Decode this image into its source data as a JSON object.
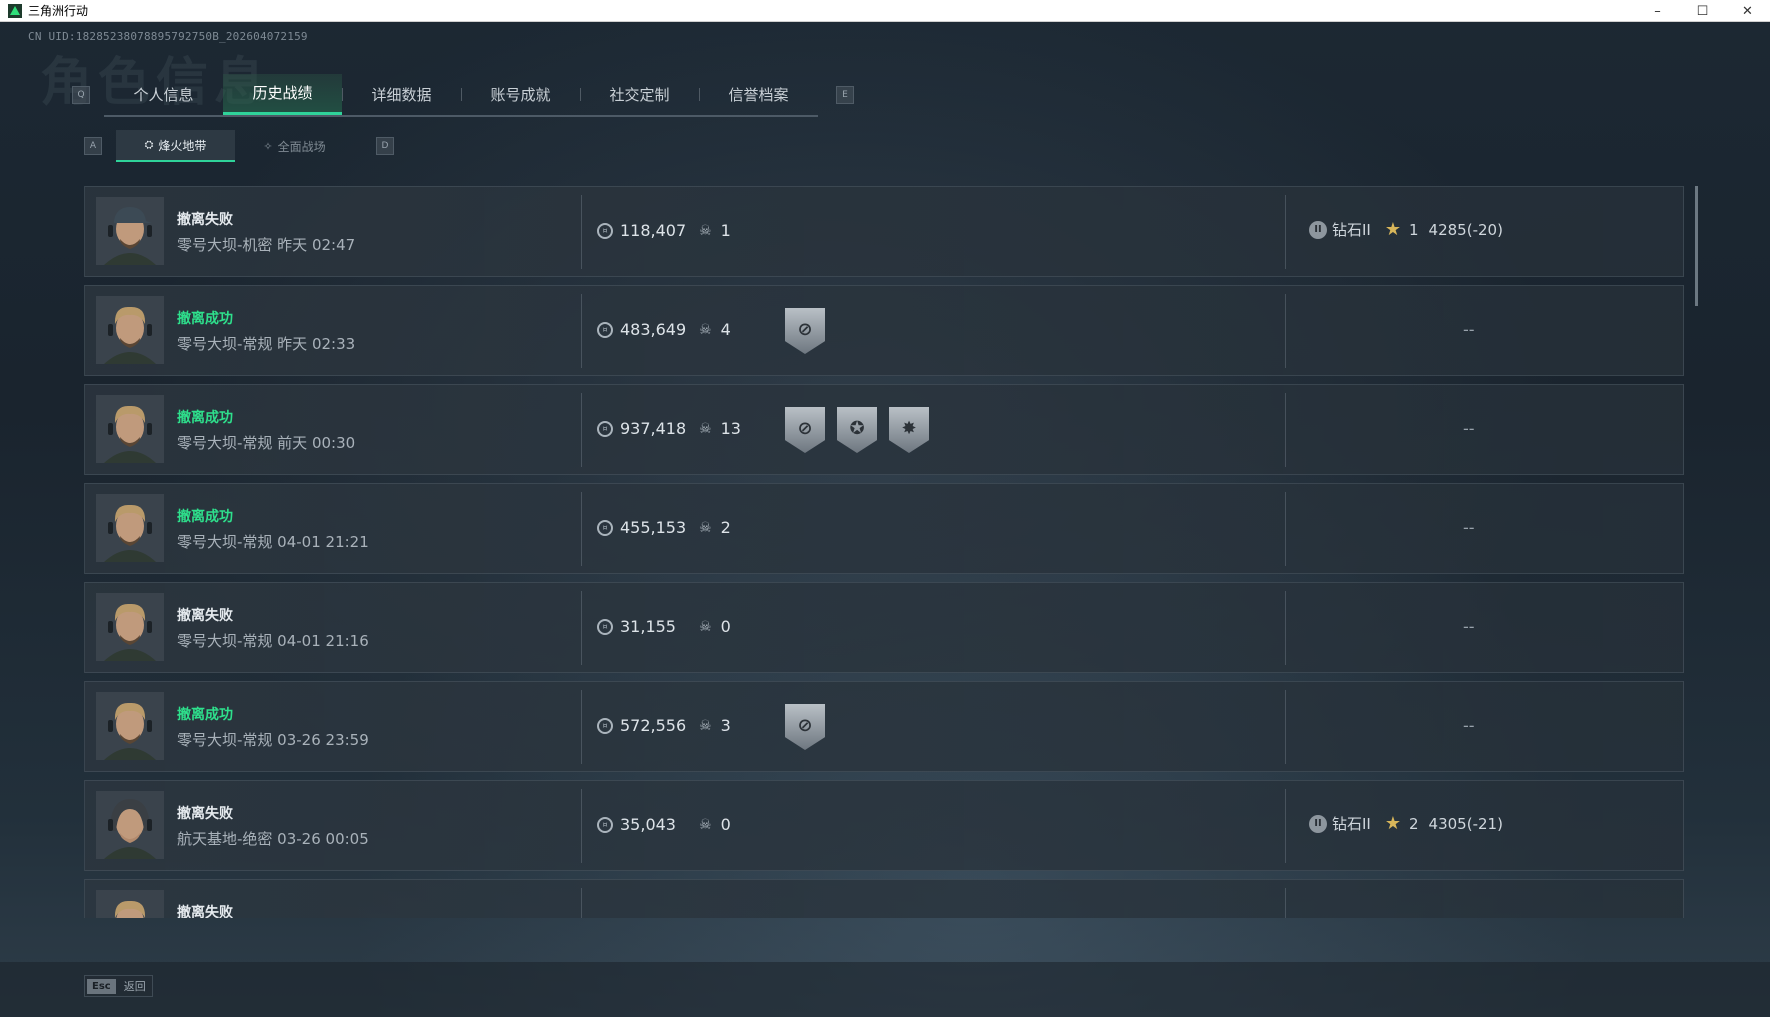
{
  "window": {
    "title": "三角洲行动",
    "controls": {
      "minimize": "–",
      "maximize": "☐",
      "close": "✕"
    }
  },
  "uid_label": "CN UID:18285238078895792750B_202604072159",
  "watermark": "角色信息",
  "tabs": {
    "prev_key": "Q",
    "next_key": "E",
    "items": [
      {
        "label": "个人信息",
        "active": false
      },
      {
        "label": "历史战绩",
        "active": true
      },
      {
        "label": "详细数据",
        "active": false
      },
      {
        "label": "账号成就",
        "active": false
      },
      {
        "label": "社交定制",
        "active": false
      },
      {
        "label": "信誉档案",
        "active": false
      }
    ]
  },
  "subtabs": {
    "prev_key": "A",
    "next_key": "D",
    "items": [
      {
        "label": "烽火地带",
        "icon": "⛭",
        "active": true
      },
      {
        "label": "全面战场",
        "icon": "✧",
        "active": false
      }
    ]
  },
  "records": [
    {
      "status": "撤离失败",
      "success": false,
      "map": "零号大坝-机密 昨天 02:47",
      "money": "118,407",
      "kills": "1",
      "badges": [],
      "rank": {
        "tier": "钻石II",
        "stars": "1",
        "score": "4285(-20)"
      },
      "avatar": "man-cap"
    },
    {
      "status": "撤离成功",
      "success": true,
      "map": "零号大坝-常规 昨天 02:33",
      "money": "483,649",
      "kills": "4",
      "badges": [
        "extract-badge"
      ],
      "rank": null,
      "placeholder": "--",
      "avatar": "man-blond"
    },
    {
      "status": "撤离成功",
      "success": true,
      "map": "零号大坝-常规 前天 00:30",
      "money": "937,418",
      "kills": "13",
      "badges": [
        "extract-badge",
        "eagle-badge",
        "burst-badge"
      ],
      "rank": null,
      "placeholder": "--",
      "avatar": "man-blond"
    },
    {
      "status": "撤离成功",
      "success": true,
      "map": "零号大坝-常规 04-01 21:21",
      "money": "455,153",
      "kills": "2",
      "badges": [],
      "rank": null,
      "placeholder": "--",
      "avatar": "man-blond"
    },
    {
      "status": "撤离失败",
      "success": false,
      "map": "零号大坝-常规 04-01 21:16",
      "money": "31,155",
      "kills": "0",
      "badges": [],
      "rank": null,
      "placeholder": "--",
      "avatar": "man-blond"
    },
    {
      "status": "撤离成功",
      "success": true,
      "map": "零号大坝-常规 03-26 23:59",
      "money": "572,556",
      "kills": "3",
      "badges": [
        "extract-badge"
      ],
      "rank": null,
      "placeholder": "--",
      "avatar": "man-blond"
    },
    {
      "status": "撤离失败",
      "success": false,
      "map": "航天基地-绝密 03-26 00:05",
      "money": "35,043",
      "kills": "0",
      "badges": [],
      "rank": {
        "tier": "钻石II",
        "stars": "2",
        "score": "4305(-21)"
      },
      "avatar": "woman-hood"
    },
    {
      "status": "撤离失败",
      "success": false,
      "map": "",
      "money": "",
      "kills": "",
      "badges": [],
      "rank": null,
      "avatar": "man-blond"
    }
  ],
  "badge_glyphs": {
    "extract-badge": "⊘",
    "eagle-badge": "✪",
    "burst-badge": "✸"
  },
  "colors": {
    "success": "#2ee08c",
    "accent": "#2fd39a"
  },
  "footer": {
    "esc_key": "Esc",
    "esc_label": "返回"
  }
}
